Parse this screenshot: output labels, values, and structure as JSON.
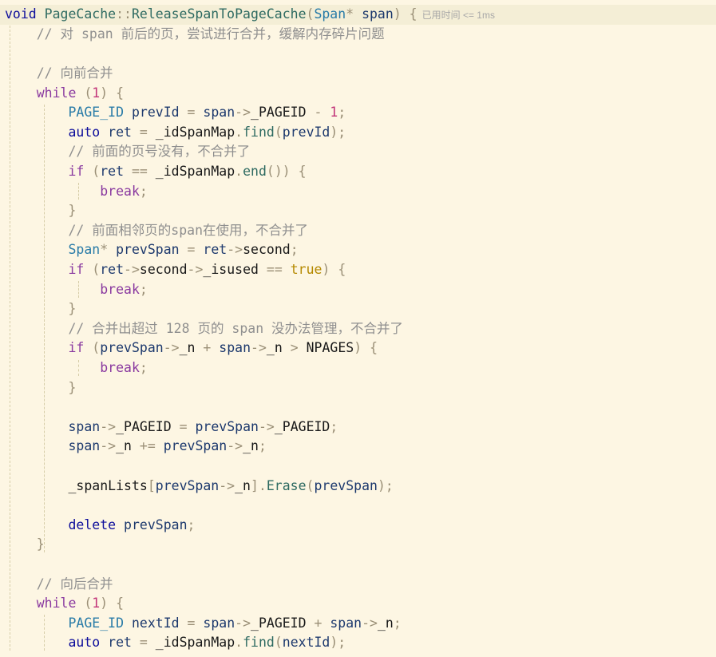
{
  "editor": {
    "perf_hint": "已用时间 <= 1ms",
    "lines": [
      [
        [
          "kw",
          "void "
        ],
        [
          "cls",
          "PageCache"
        ],
        [
          "op",
          "::"
        ],
        [
          "fn",
          "ReleaseSpanToPageCache"
        ],
        [
          "pun",
          "("
        ],
        [
          "type",
          "Span"
        ],
        [
          "pun",
          "* "
        ],
        [
          "id",
          "span"
        ],
        [
          "pun",
          ") {"
        ]
      ],
      [
        [
          "txt",
          "    "
        ],
        [
          "cmt",
          "// 对 span 前后的页，尝试进行合并，缓解内存碎片问题"
        ]
      ],
      [],
      [
        [
          "txt",
          "    "
        ],
        [
          "cmt",
          "// 向前合并"
        ]
      ],
      [
        [
          "txt",
          "    "
        ],
        [
          "ctrl",
          "while"
        ],
        [
          "pun",
          " ("
        ],
        [
          "num",
          "1"
        ],
        [
          "pun",
          ") {"
        ]
      ],
      [
        [
          "txt",
          "        "
        ],
        [
          "type",
          "PAGE_ID"
        ],
        [
          "txt",
          " "
        ],
        [
          "id",
          "prevId"
        ],
        [
          "op",
          " = "
        ],
        [
          "id",
          "span"
        ],
        [
          "op",
          "->"
        ],
        [
          "txt",
          "_PAGEID"
        ],
        [
          "op",
          " - "
        ],
        [
          "num",
          "1"
        ],
        [
          "pun",
          ";"
        ]
      ],
      [
        [
          "txt",
          "        "
        ],
        [
          "kw",
          "auto"
        ],
        [
          "txt",
          " "
        ],
        [
          "id",
          "ret"
        ],
        [
          "op",
          " = "
        ],
        [
          "txt",
          "_idSpanMap"
        ],
        [
          "op",
          "."
        ],
        [
          "fn",
          "find"
        ],
        [
          "pun",
          "("
        ],
        [
          "id",
          "prevId"
        ],
        [
          "pun",
          ");"
        ]
      ],
      [
        [
          "txt",
          "        "
        ],
        [
          "cmt",
          "// 前面的页号没有，不合并了"
        ]
      ],
      [
        [
          "txt",
          "        "
        ],
        [
          "ctrl",
          "if"
        ],
        [
          "pun",
          " ("
        ],
        [
          "id",
          "ret"
        ],
        [
          "op",
          " == "
        ],
        [
          "txt",
          "_idSpanMap"
        ],
        [
          "op",
          "."
        ],
        [
          "fn",
          "end"
        ],
        [
          "pun",
          "()) {"
        ]
      ],
      [
        [
          "txt",
          "            "
        ],
        [
          "ctrl",
          "break"
        ],
        [
          "pun",
          ";"
        ]
      ],
      [
        [
          "txt",
          "        "
        ],
        [
          "pun",
          "}"
        ]
      ],
      [
        [
          "txt",
          "        "
        ],
        [
          "cmt",
          "// 前面相邻页的span在使用，不合并了"
        ]
      ],
      [
        [
          "txt",
          "        "
        ],
        [
          "type",
          "Span"
        ],
        [
          "pun",
          "*"
        ],
        [
          "txt",
          " "
        ],
        [
          "id",
          "prevSpan"
        ],
        [
          "op",
          " = "
        ],
        [
          "id",
          "ret"
        ],
        [
          "op",
          "->"
        ],
        [
          "txt",
          "second"
        ],
        [
          "pun",
          ";"
        ]
      ],
      [
        [
          "txt",
          "        "
        ],
        [
          "ctrl",
          "if"
        ],
        [
          "pun",
          " ("
        ],
        [
          "id",
          "ret"
        ],
        [
          "op",
          "->"
        ],
        [
          "txt",
          "second"
        ],
        [
          "op",
          "->"
        ],
        [
          "txt",
          "_isused"
        ],
        [
          "op",
          " == "
        ],
        [
          "lit",
          "true"
        ],
        [
          "pun",
          ") {"
        ]
      ],
      [
        [
          "txt",
          "            "
        ],
        [
          "ctrl",
          "break"
        ],
        [
          "pun",
          ";"
        ]
      ],
      [
        [
          "txt",
          "        "
        ],
        [
          "pun",
          "}"
        ]
      ],
      [
        [
          "txt",
          "        "
        ],
        [
          "cmt",
          "// 合并出超过 128 页的 span 没办法管理，不合并了"
        ]
      ],
      [
        [
          "txt",
          "        "
        ],
        [
          "ctrl",
          "if"
        ],
        [
          "pun",
          " ("
        ],
        [
          "id",
          "prevSpan"
        ],
        [
          "op",
          "->"
        ],
        [
          "txt",
          "_n"
        ],
        [
          "op",
          " + "
        ],
        [
          "id",
          "span"
        ],
        [
          "op",
          "->"
        ],
        [
          "txt",
          "_n"
        ],
        [
          "op",
          " > "
        ],
        [
          "txt",
          "NPAGES"
        ],
        [
          "pun",
          ") {"
        ]
      ],
      [
        [
          "txt",
          "            "
        ],
        [
          "ctrl",
          "break"
        ],
        [
          "pun",
          ";"
        ]
      ],
      [
        [
          "txt",
          "        "
        ],
        [
          "pun",
          "}"
        ]
      ],
      [],
      [
        [
          "txt",
          "        "
        ],
        [
          "id",
          "span"
        ],
        [
          "op",
          "->"
        ],
        [
          "txt",
          "_PAGEID"
        ],
        [
          "op",
          " = "
        ],
        [
          "id",
          "prevSpan"
        ],
        [
          "op",
          "->"
        ],
        [
          "txt",
          "_PAGEID"
        ],
        [
          "pun",
          ";"
        ]
      ],
      [
        [
          "txt",
          "        "
        ],
        [
          "id",
          "span"
        ],
        [
          "op",
          "->"
        ],
        [
          "txt",
          "_n"
        ],
        [
          "op",
          " += "
        ],
        [
          "id",
          "prevSpan"
        ],
        [
          "op",
          "->"
        ],
        [
          "txt",
          "_n"
        ],
        [
          "pun",
          ";"
        ]
      ],
      [],
      [
        [
          "txt",
          "        "
        ],
        [
          "txt",
          "_spanLists"
        ],
        [
          "pun",
          "["
        ],
        [
          "id",
          "prevSpan"
        ],
        [
          "op",
          "->"
        ],
        [
          "txt",
          "_n"
        ],
        [
          "pun",
          "]"
        ],
        [
          "op",
          "."
        ],
        [
          "fn",
          "Erase"
        ],
        [
          "pun",
          "("
        ],
        [
          "id",
          "prevSpan"
        ],
        [
          "pun",
          ");"
        ]
      ],
      [],
      [
        [
          "txt",
          "        "
        ],
        [
          "kw",
          "delete"
        ],
        [
          "txt",
          " "
        ],
        [
          "id",
          "prevSpan"
        ],
        [
          "pun",
          ";"
        ]
      ],
      [
        [
          "txt",
          "    "
        ],
        [
          "pun",
          "}"
        ]
      ],
      [],
      [
        [
          "txt",
          "    "
        ],
        [
          "cmt",
          "// 向后合并"
        ]
      ],
      [
        [
          "txt",
          "    "
        ],
        [
          "ctrl",
          "while"
        ],
        [
          "pun",
          " ("
        ],
        [
          "num",
          "1"
        ],
        [
          "pun",
          ") {"
        ]
      ],
      [
        [
          "txt",
          "        "
        ],
        [
          "type",
          "PAGE_ID"
        ],
        [
          "txt",
          " "
        ],
        [
          "id",
          "nextId"
        ],
        [
          "op",
          " = "
        ],
        [
          "id",
          "span"
        ],
        [
          "op",
          "->"
        ],
        [
          "txt",
          "_PAGEID"
        ],
        [
          "op",
          " + "
        ],
        [
          "id",
          "span"
        ],
        [
          "op",
          "->"
        ],
        [
          "txt",
          "_n"
        ],
        [
          "pun",
          ";"
        ]
      ],
      [
        [
          "txt",
          "        "
        ],
        [
          "kw",
          "auto"
        ],
        [
          "txt",
          " "
        ],
        [
          "id",
          "ret"
        ],
        [
          "op",
          " = "
        ],
        [
          "txt",
          "_idSpanMap"
        ],
        [
          "op",
          "."
        ],
        [
          "fn",
          "find"
        ],
        [
          "pun",
          "("
        ],
        [
          "id",
          "nextId"
        ],
        [
          "pun",
          ");"
        ]
      ]
    ]
  }
}
